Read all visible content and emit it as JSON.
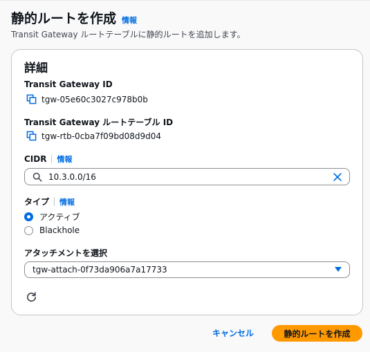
{
  "header": {
    "title": "静的ルートを作成",
    "info_link": "情報",
    "description": "Transit Gateway ルートテーブルに静的ルートを追加します。"
  },
  "details": {
    "title": "詳細",
    "tgw_id": {
      "label": "Transit Gateway ID",
      "value": "tgw-05e60c3027c978b0b",
      "icon": "copy-icon"
    },
    "route_table_id": {
      "label": "Transit Gateway ルートテーブル ID",
      "value": "tgw-rtb-0cba7f09bd08d9d04",
      "icon": "copy-icon"
    },
    "cidr": {
      "label": "CIDR",
      "info_link": "情報",
      "value": "10.3.0.0/16"
    },
    "type": {
      "label": "タイプ",
      "info_link": "情報",
      "options": [
        {
          "label": "アクティブ",
          "checked": true
        },
        {
          "label": "Blackhole",
          "checked": false
        }
      ]
    },
    "attachment": {
      "label": "アタッチメントを選択",
      "value": "tgw-attach-0f73da906a7a17733"
    }
  },
  "footer": {
    "cancel_label": "キャンセル",
    "submit_label": "静的ルートを作成"
  },
  "colors": {
    "accent": "#006ce0",
    "primary_button": "#ff9900",
    "border": "#c6c6cd"
  }
}
